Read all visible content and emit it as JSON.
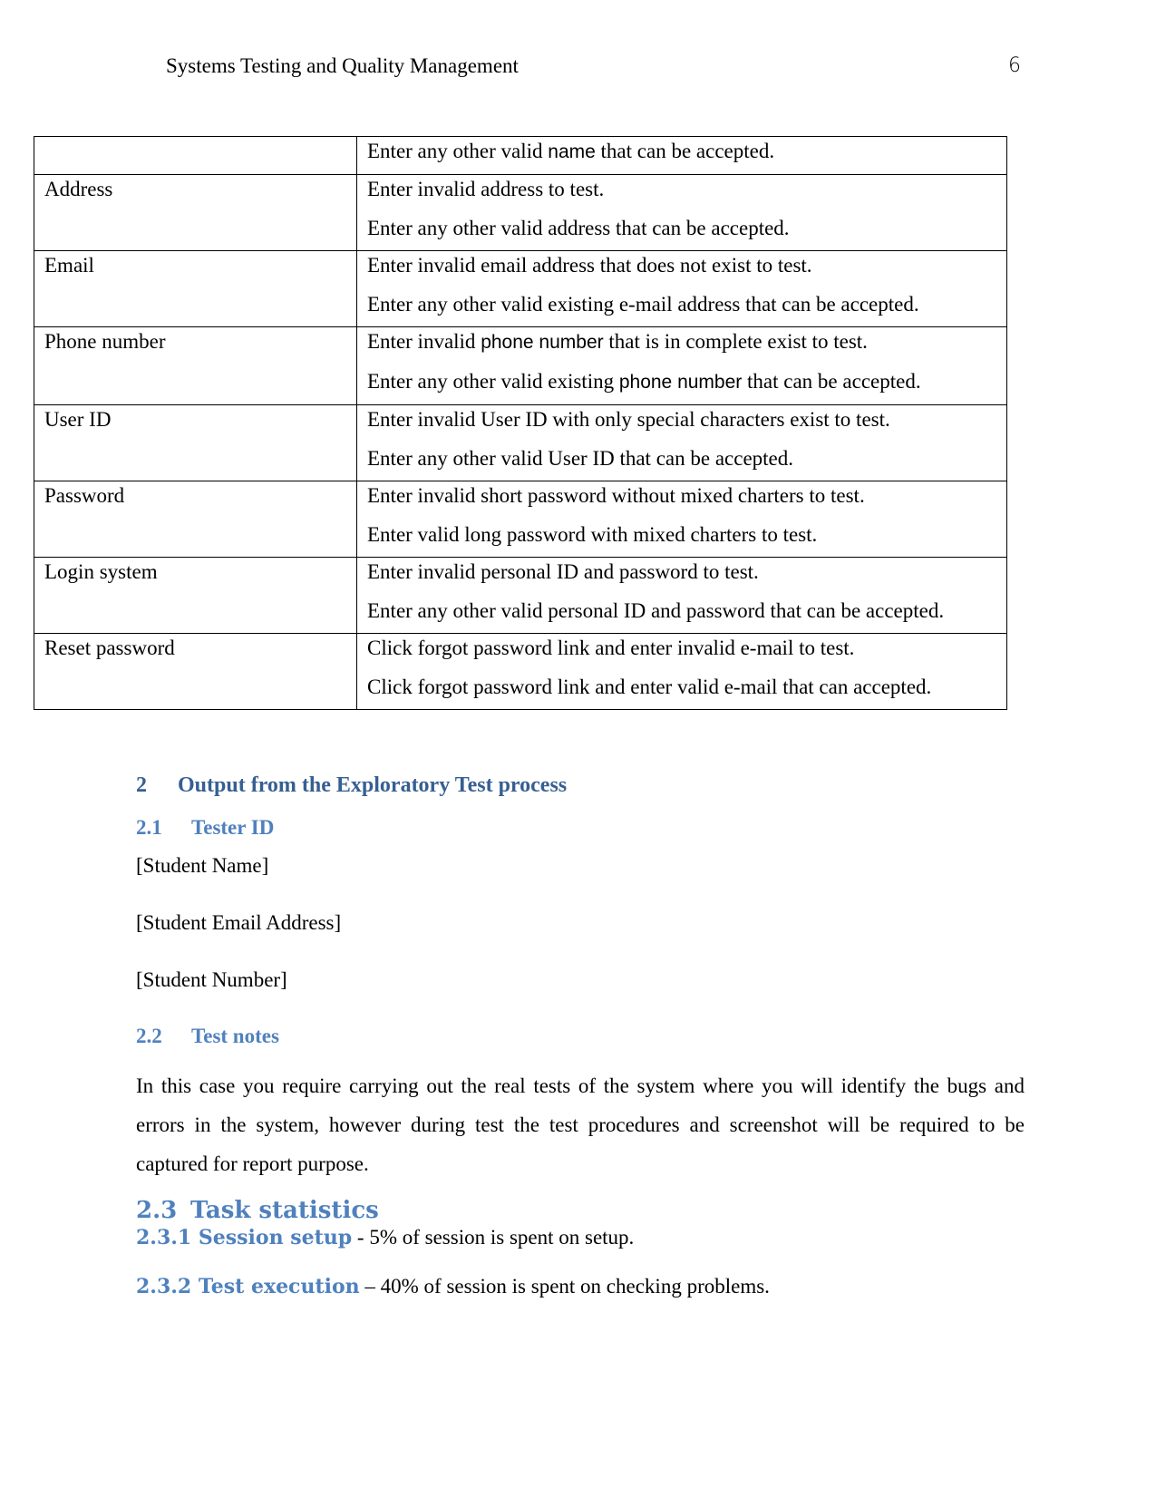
{
  "header": {
    "title": "Systems Testing and Quality Management",
    "page_number": "6"
  },
  "table": {
    "rows": [
      {
        "field": "",
        "lines": [
          "Enter any other valid name that can be accepted."
        ]
      },
      {
        "field": "Address",
        "lines": [
          "Enter invalid address to test.",
          "Enter any other valid address that can be accepted."
        ]
      },
      {
        "field": "Email",
        "lines": [
          "Enter invalid email address that does not exist to test.",
          "Enter any other valid existing e-mail address that can be accepted."
        ]
      },
      {
        "field": "Phone number",
        "lines": [
          "Enter invalid phone number that is in complete exist to test.",
          "Enter any other valid existing phone number that can be accepted."
        ]
      },
      {
        "field": "User ID",
        "lines": [
          "Enter invalid User ID with only special characters exist to test.",
          "Enter any other valid User ID that can be accepted."
        ]
      },
      {
        "field": "Password",
        "lines": [
          "Enter invalid short password without mixed charters to test.",
          "Enter valid long password with mixed charters to test."
        ]
      },
      {
        "field": "Login system",
        "lines": [
          "Enter invalid personal ID and password to test.",
          "Enter any other valid personal ID and password that can be accepted."
        ]
      },
      {
        "field": "Reset password",
        "lines": [
          "Click forgot password link and enter invalid e-mail to test.",
          "Click forgot password link and enter valid e-mail that can accepted."
        ]
      }
    ]
  },
  "section2": {
    "number": "2",
    "title": "Output from the Exploratory Test process",
    "s21": {
      "number": "2.1",
      "title": "Tester ID",
      "lines": [
        "[Student Name]",
        "[Student Email Address]",
        "[Student Number]"
      ]
    },
    "s22": {
      "number": "2.2",
      "title": "Test notes",
      "body": "In this case you require carrying out the real tests of the system where you will identify the bugs and errors in the system, however during test the test procedures and screenshot will be required to be captured for report purpose."
    },
    "s23": {
      "number": "2.3",
      "title": "Task statistics",
      "items": [
        {
          "label": "2.3.1 Session setup",
          "text": " - 5% of session is spent on setup."
        },
        {
          "label": "2.3.2 Test execution",
          "text": " – 40% of session is spent on checking problems."
        }
      ]
    }
  },
  "colors": {
    "heading1": "#365f91",
    "heading2": "#4f81bd"
  }
}
